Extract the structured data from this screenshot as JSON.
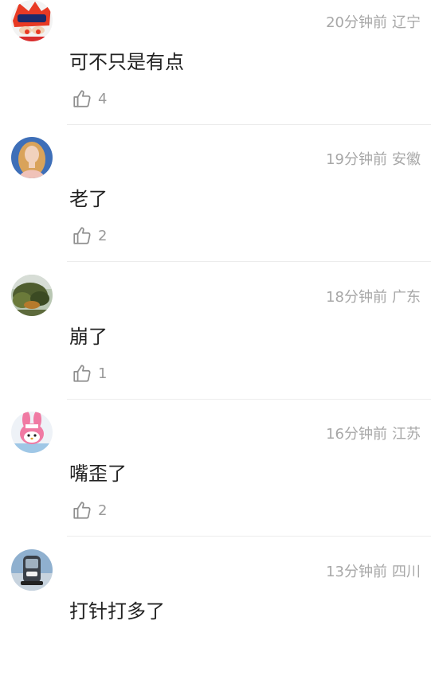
{
  "comments": [
    {
      "username": "",
      "time": "20分钟前",
      "location": "辽宁",
      "text": "可不只是有点",
      "likes": "4",
      "avatar_icon": "cartoon-character-avatar"
    },
    {
      "username": "",
      "time": "19分钟前",
      "location": "安徽",
      "text": "老了",
      "likes": "2",
      "avatar_icon": "woman-photo-avatar"
    },
    {
      "username": "",
      "time": "18分钟前",
      "location": "广东",
      "text": "崩了",
      "likes": "1",
      "avatar_icon": "tree-landscape-avatar"
    },
    {
      "username": "",
      "time": "16分钟前",
      "location": "江苏",
      "text": "嘴歪了",
      "likes": "2",
      "avatar_icon": "pink-bunny-avatar"
    },
    {
      "username": "",
      "time": "13分钟前",
      "location": "四川",
      "text": "打针打多了",
      "likes": "",
      "avatar_icon": "car-photo-avatar"
    }
  ]
}
